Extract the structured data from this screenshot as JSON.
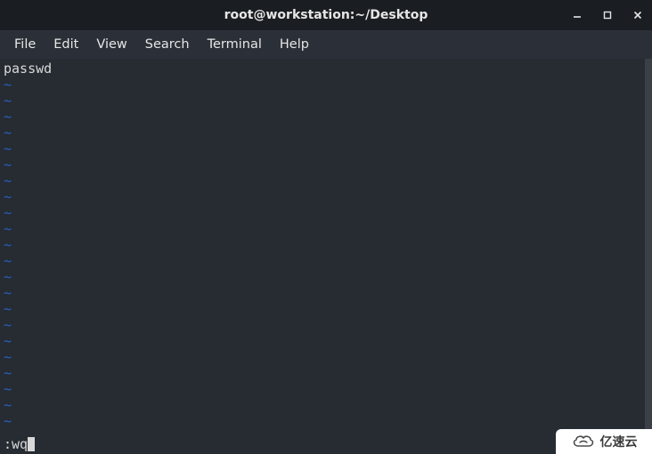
{
  "window": {
    "title": "root@workstation:~/Desktop"
  },
  "menu": {
    "file": "File",
    "edit": "Edit",
    "view": "View",
    "search": "Search",
    "terminal": "Terminal",
    "help": "Help"
  },
  "editor": {
    "content_line": "passwd",
    "tilde": "~",
    "empty_line_count": 22,
    "command_line": ":wq"
  },
  "icons": {
    "minimize": "minimize-icon",
    "maximize": "maximize-icon",
    "close": "close-icon"
  },
  "watermark": {
    "text": "亿速云"
  }
}
